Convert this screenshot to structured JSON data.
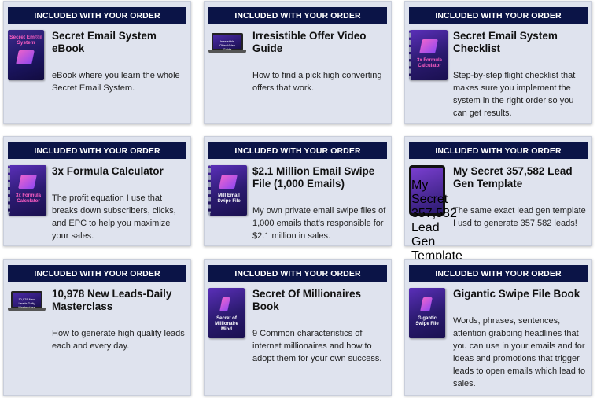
{
  "cards": [
    {
      "header": "INCLUDED WITH YOUR ORDER",
      "title": "Secret Email System eBook",
      "description": "eBook where you learn the whole Secret Email System.",
      "cover_text": "Secret Em@il System"
    },
    {
      "header": "INCLUDED WITH YOUR ORDER",
      "title": "Irresistible Offer Video Guide",
      "description": "How to find a pick high converting offers that work.",
      "cover_text": "Irresistible Offer Video Guide"
    },
    {
      "header": "INCLUDED WITH YOUR ORDER",
      "title": "Secret Email System Checklist",
      "description": "Step-by-step flight checklist that makes sure you implement the system in the right order so you can get results.",
      "cover_text": "3x Formula Calculator"
    },
    {
      "header": "INCLUDED WITH YOUR ORDER",
      "title": "3x Formula Calculator",
      "description": "The profit equation I use that breaks down subscribers, clicks, and EPC to help you maximize your sales.",
      "cover_text": "3x Formula Calculator"
    },
    {
      "header": "INCLUDED WITH YOUR ORDER",
      "title": "$2.1 Million Email Swipe File (1,000 Emails)",
      "description": "My own private email swipe files of 1,000 emails that's responsible for $2.1 million in sales.",
      "cover_text": "Mill Email Swipe File"
    },
    {
      "header": "INCLUDED WITH YOUR ORDER",
      "title": "My Secret 357,582 Lead Gen Template",
      "description": "The same exact lead gen template I usd to generate 357,582 leads!",
      "cover_text": "My Secret 357,582 Lead Gen Template"
    },
    {
      "header": "INCLUDED WITH YOUR ORDER",
      "title": "10,978 New Leads-Daily Masterclass",
      "description": "How to generate high quality leads each and every day.",
      "cover_text": "10,978 New Leads Daily Masterclass"
    },
    {
      "header": "INCLUDED WITH YOUR ORDER",
      "title": "Secret Of Millionaires Book",
      "description": "9 Common characteristics of internet millionaires and how to adopt them for your own success.",
      "cover_text": "Secret of Millionaire Mind"
    },
    {
      "header": "INCLUDED WITH YOUR ORDER",
      "title": "Gigantic Swipe File Book",
      "description": "Words, phrases, sentences, attention grabbing headlines that you can use in your emails and for ideas and promotions that trigger leads to open emails which lead to sales.",
      "cover_text": "Gigantic Swipe File"
    }
  ],
  "colors": {
    "header_bg": "#0b1447",
    "card_bg": "#dfe3ee",
    "cover_purple": "#5a2fb8",
    "cover_pink": "#ff5fc4"
  }
}
